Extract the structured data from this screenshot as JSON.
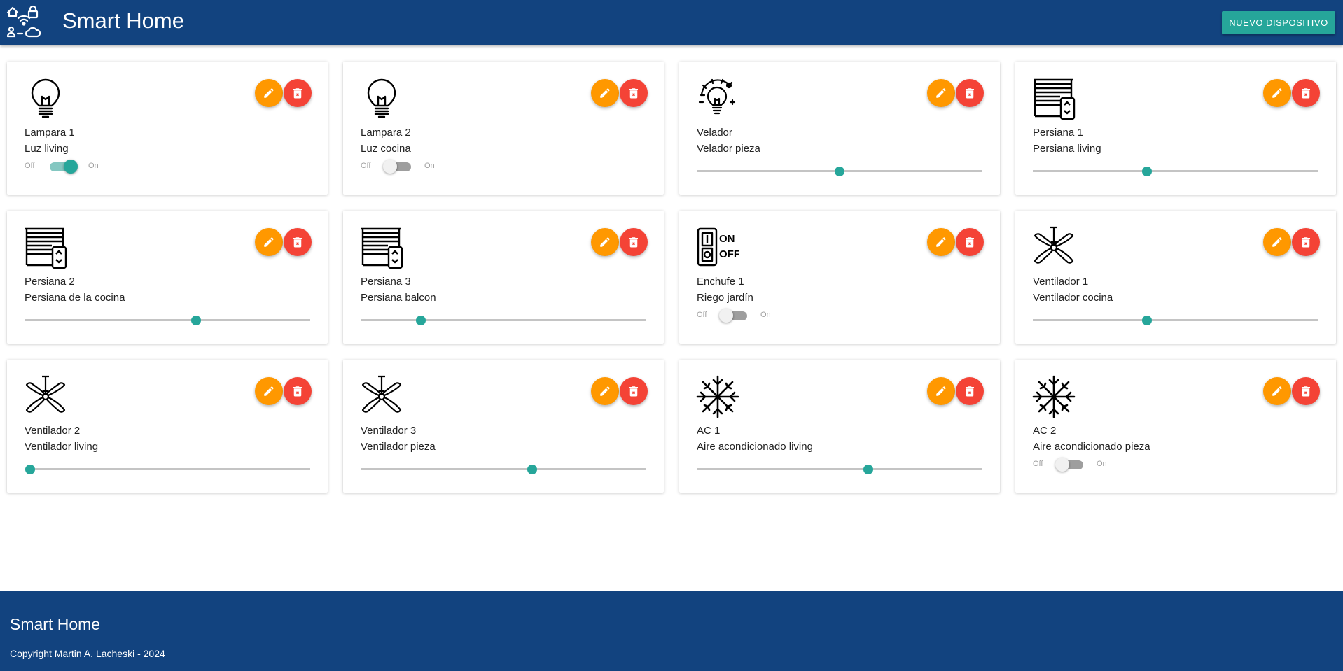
{
  "header": {
    "title": "Smart Home",
    "logo_icon": "smart-home-logo-icon",
    "new_device_label": "NUEVO DISPOSITIVO"
  },
  "colors": {
    "primary": "#12437f",
    "accent": "#26a69a",
    "edit": "#ff9800",
    "delete": "#f44336"
  },
  "devices": [
    {
      "name": "Lampara 1",
      "description": "Luz living",
      "icon": "lightbulb-icon",
      "control": "switch",
      "state": true
    },
    {
      "name": "Lampara 2",
      "description": "Luz cocina",
      "icon": "lightbulb-icon",
      "control": "switch",
      "state": false
    },
    {
      "name": "Velador",
      "description": "Velador pieza",
      "icon": "dimmable-lamp-icon",
      "control": "slider",
      "level": 0.5
    },
    {
      "name": "Persiana 1",
      "description": "Persiana living",
      "icon": "window-blind-icon",
      "control": "slider",
      "level": 0.4
    },
    {
      "name": "Persiana 2",
      "description": "Persiana de la cocina",
      "icon": "window-blind-icon",
      "control": "slider",
      "level": 0.6
    },
    {
      "name": "Persiana 3",
      "description": "Persiana balcon",
      "icon": "window-blind-icon",
      "control": "slider",
      "level": 0.21
    },
    {
      "name": "Enchufe 1",
      "description": "Riego jardín",
      "icon": "on-off-switch-icon",
      "control": "switch",
      "state": false
    },
    {
      "name": "Ventilador 1",
      "description": "Ventilador cocina",
      "icon": "ceiling-fan-icon",
      "control": "slider",
      "level": 0.4
    },
    {
      "name": "Ventilador 2",
      "description": "Ventilador living",
      "icon": "ceiling-fan-icon",
      "control": "slider",
      "level": 0.02
    },
    {
      "name": "Ventilador 3",
      "description": "Ventilador pieza",
      "icon": "ceiling-fan-icon",
      "control": "slider",
      "level": 0.6
    },
    {
      "name": "AC 1",
      "description": "Aire acondicionado living",
      "icon": "snowflake-icon",
      "control": "slider",
      "level": 0.6
    },
    {
      "name": "AC 2",
      "description": "Aire acondicionado pieza",
      "icon": "snowflake-icon",
      "control": "switch",
      "state": false
    }
  ],
  "switch_labels": {
    "off": "Off",
    "on": "On"
  },
  "actions": {
    "edit_icon": "pencil-icon",
    "delete_icon": "trash-icon"
  },
  "footer": {
    "title": "Smart Home",
    "copyright": "Copyright Martin A. Lacheski - 2024"
  }
}
